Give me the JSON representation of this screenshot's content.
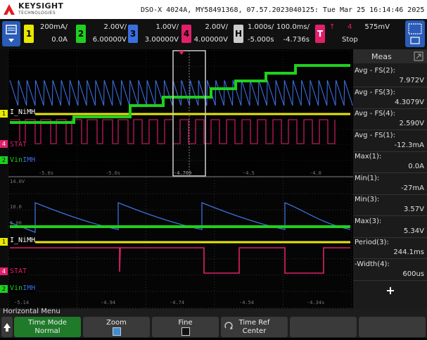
{
  "header": {
    "brand": "KEYSIGHT",
    "brand_sub": "TECHNOLOGIES",
    "title": "DSO-X 4024A, MY58491368, 07.57.2023040125: Tue Mar 25 16:14:46 2025"
  },
  "channels": [
    {
      "num": "1",
      "scale": "200mA/",
      "offset": "0.0A",
      "color": "#e8e800"
    },
    {
      "num": "2",
      "scale": "2.00V/",
      "offset": "6.00000V",
      "color": "#1fd01f"
    },
    {
      "num": "3",
      "scale": "1.00V/",
      "offset": "3.00000V",
      "color": "#3b6fe0"
    },
    {
      "num": "4",
      "scale": "2.00V/",
      "offset": "4.00000V",
      "color": "#e0206a"
    }
  ],
  "horizontal": {
    "label": "H",
    "scale": "1.000s/",
    "delay": "-5.000s",
    "zoom_scale": "100.0ms/",
    "zoom_delay": "-4.736s"
  },
  "trigger": {
    "label": "T",
    "source": "4",
    "slope": "↑",
    "level": "575mV",
    "state": "Stop"
  },
  "meas": {
    "title": "Meas",
    "items": [
      {
        "label": "Avg - FS(2):",
        "value": "7.972V"
      },
      {
        "label": "Avg - FS(3):",
        "value": "4.3079V"
      },
      {
        "label": "Avg - FS(4):",
        "value": "2.590V"
      },
      {
        "label": "Avg - FS(1):",
        "value": "-12.3mA"
      },
      {
        "label": "Max(1):",
        "value": "0.0A"
      },
      {
        "label": "Min(1):",
        "value": "-27mA"
      },
      {
        "label": "Min(3):",
        "value": "3.57V"
      },
      {
        "label": "Max(3):",
        "value": "5.34V"
      },
      {
        "label": "Period(3):",
        "value": "244.1ms"
      },
      {
        "label": "-Width(4):",
        "value": "600us"
      }
    ],
    "add": "+"
  },
  "labels": {
    "inimh": "I_NiMH",
    "stat": "STAT",
    "vin_a": "Vin",
    "vin_b": "IMH"
  },
  "ticks_top": [
    "-5.0s",
    "-5.0s",
    "-4.709",
    "-4.5",
    "-4.0"
  ],
  "ticks_bottom": [
    "-5.14",
    "-4.94",
    "-4.74",
    "-4.54",
    "-4.34s"
  ],
  "zoom_grid_labels": [
    "14.0V",
    "10.0",
    "6.00"
  ],
  "menu": {
    "title": "Horizontal Menu",
    "softkeys": [
      {
        "label": "Time Mode",
        "value": "Normal"
      },
      {
        "label": "Zoom",
        "value": ""
      },
      {
        "label": "Fine",
        "value": ""
      },
      {
        "label": "Time Ref",
        "value": "Center"
      }
    ]
  },
  "colors": {
    "ch1": "#e8e800",
    "ch2": "#1fd01f",
    "ch3": "#3b6fe0",
    "ch4": "#e0206a",
    "accent": "#3a8fd8"
  }
}
